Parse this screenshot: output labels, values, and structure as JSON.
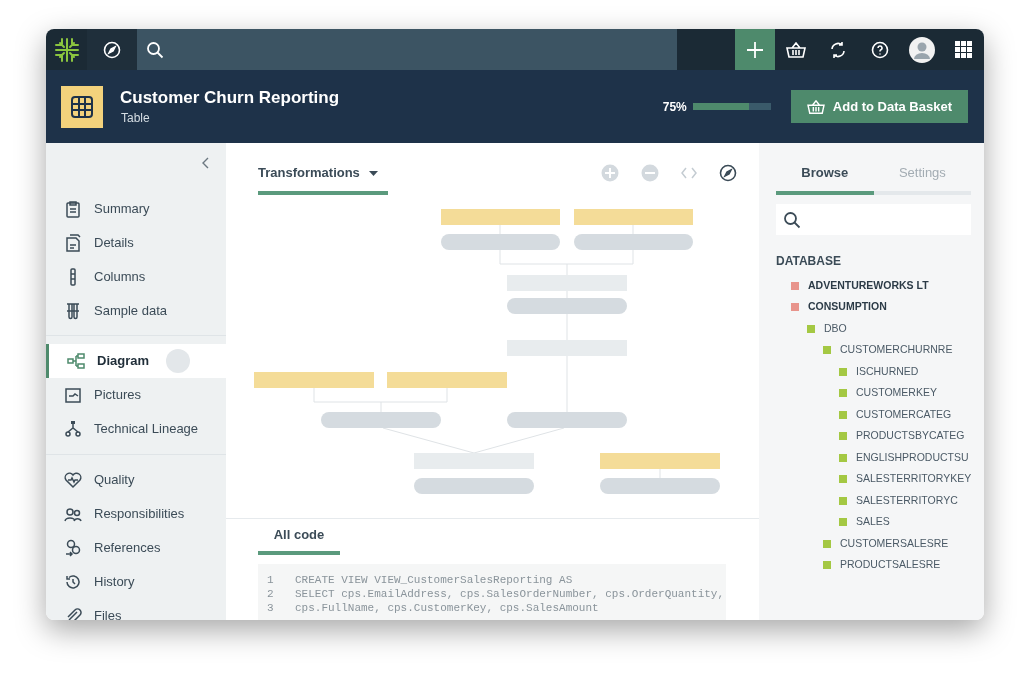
{
  "header": {
    "title": "Customer Churn Reporting",
    "subtitle": "Table",
    "completeness": "75%",
    "level": 0.72,
    "action": "Add to Data Basket"
  },
  "sidebar": {
    "sections": [
      {
        "items": [
          {
            "label": "Summary",
            "selected": false
          },
          {
            "label": "Details",
            "selected": false
          },
          {
            "label": "Columns",
            "selected": false
          },
          {
            "label": "Sample data",
            "selected": false
          }
        ]
      },
      {
        "items": [
          {
            "label": "Diagram",
            "selected": true
          },
          {
            "label": "Pictures",
            "selected": false
          },
          {
            "label": "Technical Lineage",
            "selected": false
          }
        ]
      },
      {
        "items": [
          {
            "label": "Quality",
            "selected": false
          },
          {
            "label": "Responsibilities",
            "selected": false
          },
          {
            "label": "References",
            "selected": false
          },
          {
            "label": "History",
            "selected": false
          },
          {
            "label": "Files",
            "selected": false
          }
        ]
      }
    ]
  },
  "diagram": {
    "view": "Transformations"
  },
  "code": {
    "tab": "All code",
    "lines": [
      {
        "number": "1",
        "text": "CREATE VIEW VIEW_CustomerSalesReporting AS"
      },
      {
        "number": "2",
        "text": "SELECT cps.EmailAddress, cps.SalesOrderNumber, cps.OrderQuantity,"
      },
      {
        "number": "3",
        "text": "cps.FullName, cps.CustomerKey, cps.SalesAmount"
      }
    ]
  },
  "browse": {
    "tabs": [
      {
        "label": "Browse",
        "selected": true
      },
      {
        "label": "Settings",
        "selected": false
      }
    ],
    "section": "DATABASE",
    "tree": [
      {
        "label": "ADVENTUREWORKS LT",
        "color": "#e8948c"
      },
      {
        "label": "CONSUMPTION",
        "color": "#e8948c",
        "children": [
          {
            "label": "DBO",
            "color": "#a4c843",
            "children": [
              {
                "label": "CUSTOMERCHURNRE",
                "color": "#a4c843",
                "children": [
                  {
                    "label": "ISCHURNED",
                    "color": "#a4c843"
                  },
                  {
                    "label": "CUSTOMERKEY",
                    "color": "#a4c843"
                  },
                  {
                    "label": "CUSTOMERCATEG",
                    "color": "#a4c843"
                  },
                  {
                    "label": "PRODUCTSBYCATEG",
                    "color": "#a4c843"
                  },
                  {
                    "label": "ENGLISHPRODUCTSU",
                    "color": "#a4c843"
                  },
                  {
                    "label": "SALESTERRITORYKEY",
                    "color": "#a4c843"
                  },
                  {
                    "label": "SALESTERRITORYC",
                    "color": "#a4c843"
                  },
                  {
                    "label": "SALES",
                    "color": "#a4c843"
                  }
                ]
              },
              {
                "label": "CUSTOMERSALESRE",
                "color": "#a4c843"
              },
              {
                "label": "PRODUCTSALESRE",
                "color": "#a4c843"
              }
            ]
          }
        ]
      }
    ]
  }
}
